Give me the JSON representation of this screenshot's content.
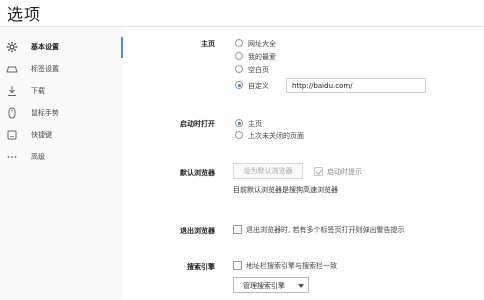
{
  "page": {
    "title": "选项"
  },
  "sidebar": {
    "items": [
      {
        "label": "基本设置",
        "icon": "gear-icon",
        "active": true
      },
      {
        "label": "标签设置",
        "icon": "tab-icon",
        "active": false
      },
      {
        "label": "下载",
        "icon": "download-icon",
        "active": false
      },
      {
        "label": "鼠标手势",
        "icon": "mouse-icon",
        "active": false
      },
      {
        "label": "快捷键",
        "icon": "keyboard-icon",
        "active": false
      },
      {
        "label": "高级",
        "icon": "more-dots-icon",
        "active": false
      }
    ],
    "accent_color": "#4a8fe7"
  },
  "homepage": {
    "label": "主页",
    "options": [
      "网址大全",
      "我的最爱",
      "空白页",
      "自定义"
    ],
    "selected": "自定义",
    "url_value": "http://baidu.com/"
  },
  "startup": {
    "label": "启动时打开",
    "options": [
      "主页",
      "上次未关闭的页面"
    ],
    "selected": "主页"
  },
  "default_browser": {
    "label": "默认浏览器",
    "button_label": "设为默认浏览器",
    "checkbox_label": "启动时提示",
    "checkbox_checked": true,
    "status_text": "目前默认浏览器是搜狗高速浏览器"
  },
  "exit_browser": {
    "label": "退出浏览器",
    "checkbox_label": "退出浏览器时, 若有多个标签页打开则弹出警告提示",
    "checkbox_checked": false
  },
  "search_engine": {
    "label": "搜索引擎",
    "checkbox_label": "地址栏搜索引擎与搜索栏一致",
    "checkbox_checked": false,
    "manage_button_label": "管理搜索引擎"
  }
}
